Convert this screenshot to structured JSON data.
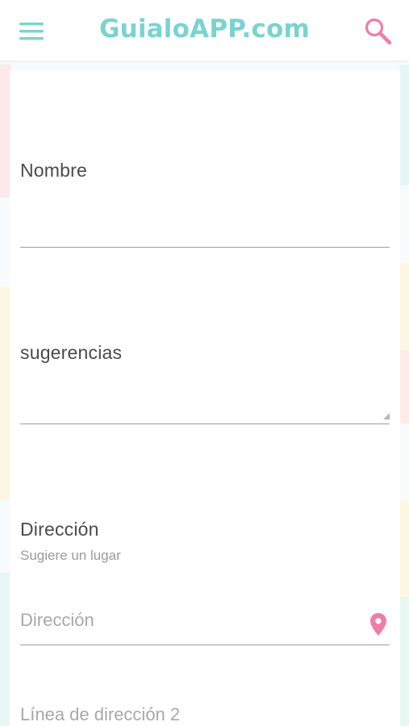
{
  "header": {
    "title": "GuialoAPP.com",
    "menu_icon": "hamburger-menu-icon",
    "search_icon": "search-icon"
  },
  "colors": {
    "accent": "#7ad3d0",
    "search": "#f07ca8",
    "pin": "#f07ca8"
  },
  "form": {
    "nombre": {
      "label": "Nombre",
      "value": ""
    },
    "sugerencias": {
      "label": "sugerencias",
      "value": ""
    },
    "direccion": {
      "label": "Dirección",
      "hint": "Sugiere un lugar",
      "address_placeholder": "Dirección",
      "address_value": "",
      "address2_placeholder": "Línea de dirección 2",
      "pin_icon": "location-pin-icon"
    }
  }
}
